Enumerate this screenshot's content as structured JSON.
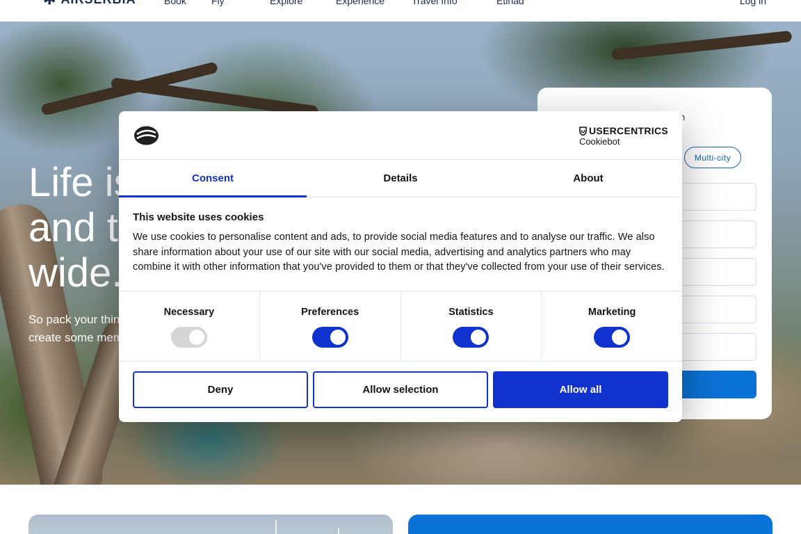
{
  "nav": {
    "brand": "AIRSERBIA",
    "items": [
      "Book",
      "Fly",
      "Explore",
      "Experience",
      "Travel Info",
      "Etihad"
    ],
    "login": "Log in"
  },
  "hero": {
    "headline_line1": "Life is",
    "headline_line2": "and t",
    "headline_line3": "wide.",
    "sub_line1": "So pack your thin",
    "sub_line2": "create some mem"
  },
  "booking": {
    "partial_label": "n",
    "multicity": "Multi-city"
  },
  "cookie_dialog": {
    "provider_brand": "USERCENTRICS",
    "provider_name": "Cookiebot",
    "tabs": [
      {
        "label": "Consent",
        "active": true
      },
      {
        "label": "Details",
        "active": false
      },
      {
        "label": "About",
        "active": false
      }
    ],
    "title": "This website uses cookies",
    "text": "We use cookies to personalise content and ads, to provide social media features and to analyse our traffic. We also share information about your use of our site with our social media, advertising and analytics partners who may combine it with other information that you've provided to them or that they've collected from your use of their services.",
    "categories": [
      {
        "label": "Necessary",
        "enabled": true,
        "locked": true
      },
      {
        "label": "Preferences",
        "enabled": true,
        "locked": false
      },
      {
        "label": "Statistics",
        "enabled": true,
        "locked": false
      },
      {
        "label": "Marketing",
        "enabled": true,
        "locked": false
      }
    ],
    "buttons": {
      "deny": "Deny",
      "allow_selection": "Allow selection",
      "allow_all": "Allow all"
    }
  },
  "colors": {
    "accent": "#1032cf",
    "brand_navy": "#1b2a4e",
    "booking_blue": "#0b72d7"
  }
}
